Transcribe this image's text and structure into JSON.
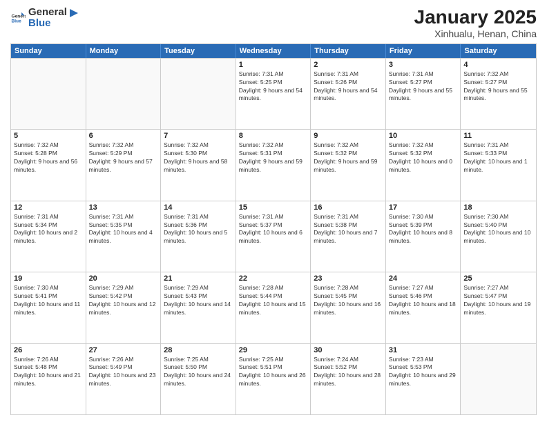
{
  "header": {
    "logo": {
      "text_general": "General",
      "text_blue": "Blue"
    },
    "title": "January 2025",
    "subtitle": "Xinhualu, Henan, China"
  },
  "calendar": {
    "days_of_week": [
      "Sunday",
      "Monday",
      "Tuesday",
      "Wednesday",
      "Thursday",
      "Friday",
      "Saturday"
    ],
    "weeks": [
      [
        {
          "date": "",
          "sunrise": "",
          "sunset": "",
          "daylight": ""
        },
        {
          "date": "",
          "sunrise": "",
          "sunset": "",
          "daylight": ""
        },
        {
          "date": "",
          "sunrise": "",
          "sunset": "",
          "daylight": ""
        },
        {
          "date": "1",
          "sunrise": "Sunrise: 7:31 AM",
          "sunset": "Sunset: 5:25 PM",
          "daylight": "Daylight: 9 hours and 54 minutes."
        },
        {
          "date": "2",
          "sunrise": "Sunrise: 7:31 AM",
          "sunset": "Sunset: 5:26 PM",
          "daylight": "Daylight: 9 hours and 54 minutes."
        },
        {
          "date": "3",
          "sunrise": "Sunrise: 7:31 AM",
          "sunset": "Sunset: 5:27 PM",
          "daylight": "Daylight: 9 hours and 55 minutes."
        },
        {
          "date": "4",
          "sunrise": "Sunrise: 7:32 AM",
          "sunset": "Sunset: 5:27 PM",
          "daylight": "Daylight: 9 hours and 55 minutes."
        }
      ],
      [
        {
          "date": "5",
          "sunrise": "Sunrise: 7:32 AM",
          "sunset": "Sunset: 5:28 PM",
          "daylight": "Daylight: 9 hours and 56 minutes."
        },
        {
          "date": "6",
          "sunrise": "Sunrise: 7:32 AM",
          "sunset": "Sunset: 5:29 PM",
          "daylight": "Daylight: 9 hours and 57 minutes."
        },
        {
          "date": "7",
          "sunrise": "Sunrise: 7:32 AM",
          "sunset": "Sunset: 5:30 PM",
          "daylight": "Daylight: 9 hours and 58 minutes."
        },
        {
          "date": "8",
          "sunrise": "Sunrise: 7:32 AM",
          "sunset": "Sunset: 5:31 PM",
          "daylight": "Daylight: 9 hours and 59 minutes."
        },
        {
          "date": "9",
          "sunrise": "Sunrise: 7:32 AM",
          "sunset": "Sunset: 5:32 PM",
          "daylight": "Daylight: 9 hours and 59 minutes."
        },
        {
          "date": "10",
          "sunrise": "Sunrise: 7:32 AM",
          "sunset": "Sunset: 5:32 PM",
          "daylight": "Daylight: 10 hours and 0 minutes."
        },
        {
          "date": "11",
          "sunrise": "Sunrise: 7:31 AM",
          "sunset": "Sunset: 5:33 PM",
          "daylight": "Daylight: 10 hours and 1 minute."
        }
      ],
      [
        {
          "date": "12",
          "sunrise": "Sunrise: 7:31 AM",
          "sunset": "Sunset: 5:34 PM",
          "daylight": "Daylight: 10 hours and 2 minutes."
        },
        {
          "date": "13",
          "sunrise": "Sunrise: 7:31 AM",
          "sunset": "Sunset: 5:35 PM",
          "daylight": "Daylight: 10 hours and 4 minutes."
        },
        {
          "date": "14",
          "sunrise": "Sunrise: 7:31 AM",
          "sunset": "Sunset: 5:36 PM",
          "daylight": "Daylight: 10 hours and 5 minutes."
        },
        {
          "date": "15",
          "sunrise": "Sunrise: 7:31 AM",
          "sunset": "Sunset: 5:37 PM",
          "daylight": "Daylight: 10 hours and 6 minutes."
        },
        {
          "date": "16",
          "sunrise": "Sunrise: 7:31 AM",
          "sunset": "Sunset: 5:38 PM",
          "daylight": "Daylight: 10 hours and 7 minutes."
        },
        {
          "date": "17",
          "sunrise": "Sunrise: 7:30 AM",
          "sunset": "Sunset: 5:39 PM",
          "daylight": "Daylight: 10 hours and 8 minutes."
        },
        {
          "date": "18",
          "sunrise": "Sunrise: 7:30 AM",
          "sunset": "Sunset: 5:40 PM",
          "daylight": "Daylight: 10 hours and 10 minutes."
        }
      ],
      [
        {
          "date": "19",
          "sunrise": "Sunrise: 7:30 AM",
          "sunset": "Sunset: 5:41 PM",
          "daylight": "Daylight: 10 hours and 11 minutes."
        },
        {
          "date": "20",
          "sunrise": "Sunrise: 7:29 AM",
          "sunset": "Sunset: 5:42 PM",
          "daylight": "Daylight: 10 hours and 12 minutes."
        },
        {
          "date": "21",
          "sunrise": "Sunrise: 7:29 AM",
          "sunset": "Sunset: 5:43 PM",
          "daylight": "Daylight: 10 hours and 14 minutes."
        },
        {
          "date": "22",
          "sunrise": "Sunrise: 7:28 AM",
          "sunset": "Sunset: 5:44 PM",
          "daylight": "Daylight: 10 hours and 15 minutes."
        },
        {
          "date": "23",
          "sunrise": "Sunrise: 7:28 AM",
          "sunset": "Sunset: 5:45 PM",
          "daylight": "Daylight: 10 hours and 16 minutes."
        },
        {
          "date": "24",
          "sunrise": "Sunrise: 7:27 AM",
          "sunset": "Sunset: 5:46 PM",
          "daylight": "Daylight: 10 hours and 18 minutes."
        },
        {
          "date": "25",
          "sunrise": "Sunrise: 7:27 AM",
          "sunset": "Sunset: 5:47 PM",
          "daylight": "Daylight: 10 hours and 19 minutes."
        }
      ],
      [
        {
          "date": "26",
          "sunrise": "Sunrise: 7:26 AM",
          "sunset": "Sunset: 5:48 PM",
          "daylight": "Daylight: 10 hours and 21 minutes."
        },
        {
          "date": "27",
          "sunrise": "Sunrise: 7:26 AM",
          "sunset": "Sunset: 5:49 PM",
          "daylight": "Daylight: 10 hours and 23 minutes."
        },
        {
          "date": "28",
          "sunrise": "Sunrise: 7:25 AM",
          "sunset": "Sunset: 5:50 PM",
          "daylight": "Daylight: 10 hours and 24 minutes."
        },
        {
          "date": "29",
          "sunrise": "Sunrise: 7:25 AM",
          "sunset": "Sunset: 5:51 PM",
          "daylight": "Daylight: 10 hours and 26 minutes."
        },
        {
          "date": "30",
          "sunrise": "Sunrise: 7:24 AM",
          "sunset": "Sunset: 5:52 PM",
          "daylight": "Daylight: 10 hours and 28 minutes."
        },
        {
          "date": "31",
          "sunrise": "Sunrise: 7:23 AM",
          "sunset": "Sunset: 5:53 PM",
          "daylight": "Daylight: 10 hours and 29 minutes."
        },
        {
          "date": "",
          "sunrise": "",
          "sunset": "",
          "daylight": ""
        }
      ]
    ]
  }
}
